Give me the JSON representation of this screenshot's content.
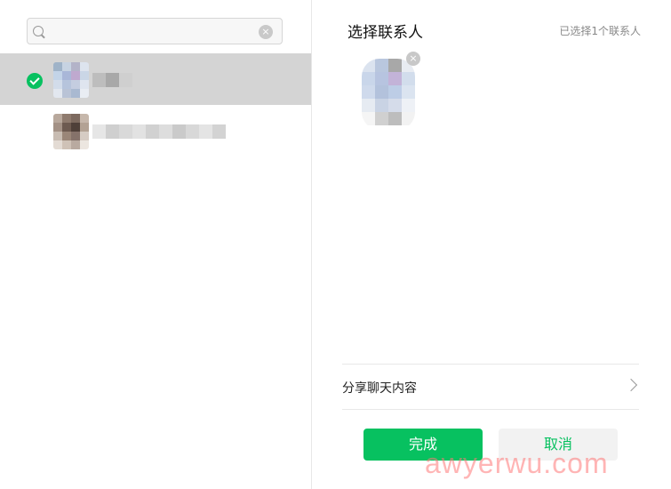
{
  "search": {
    "value": "",
    "placeholder": ""
  },
  "contacts": [
    {
      "name": "",
      "selected": true
    },
    {
      "name": "",
      "selected": false
    }
  ],
  "panel": {
    "title": "选择联系人",
    "count_label": "已选择1个联系人"
  },
  "share": {
    "label": "分享聊天内容"
  },
  "buttons": {
    "ok": "完成",
    "cancel": "取消"
  },
  "watermark": "awyerwu.com",
  "colors": {
    "accent": "#07c160",
    "selected_bg": "#d4d4d4"
  },
  "icons": {
    "search": "search-icon",
    "clear": "clear-icon",
    "check": "check-icon",
    "remove": "remove-icon",
    "chevron": "chevron-right-icon"
  }
}
